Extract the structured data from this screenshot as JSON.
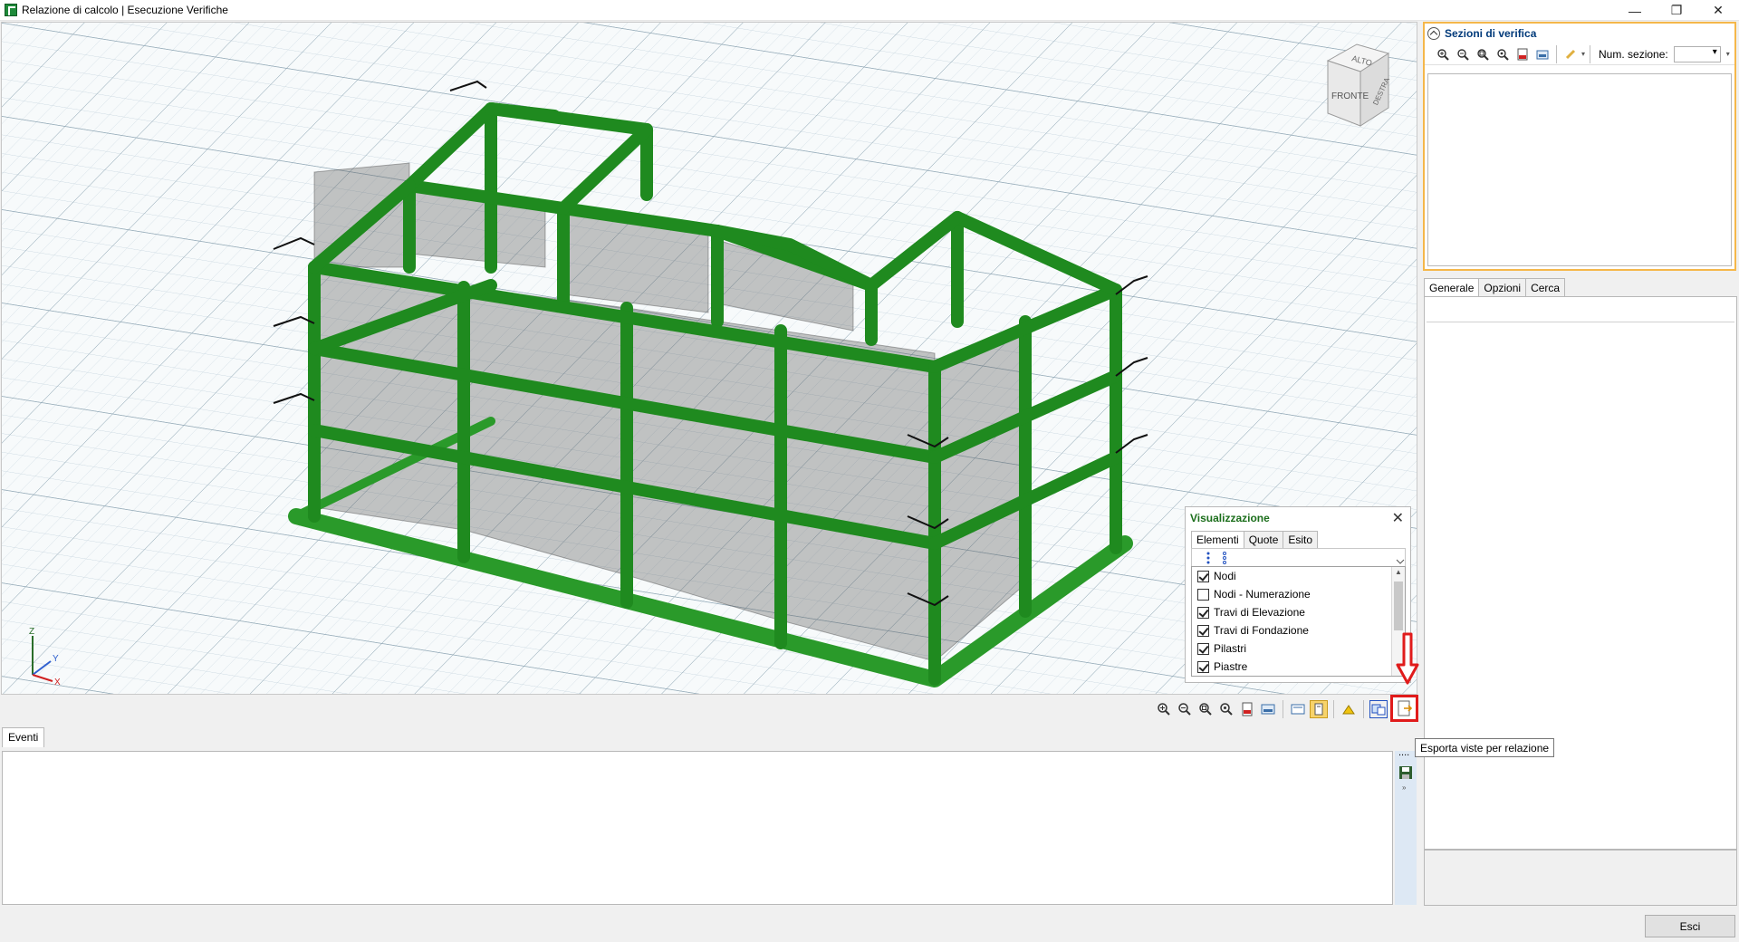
{
  "window": {
    "title": "Relazione di calcolo | Esecuzione Verifiche",
    "controls": {
      "minimize": "—",
      "restore": "❐",
      "close": "✕"
    }
  },
  "viewcube": {
    "top": "ALTO",
    "front": "FRONTE",
    "right": "DESTRA"
  },
  "triad": {
    "x": "X",
    "y": "Y",
    "z": "Z"
  },
  "visualizzazione": {
    "title": "Visualizzazione",
    "close": "✕",
    "tabs": [
      "Elementi",
      "Quote",
      "Esito"
    ],
    "active_tab": "Elementi",
    "items": [
      {
        "label": "Nodi",
        "checked": true
      },
      {
        "label": "Nodi - Numerazione",
        "checked": false
      },
      {
        "label": "Travi di Elevazione",
        "checked": true
      },
      {
        "label": "Travi di Fondazione",
        "checked": true
      },
      {
        "label": "Pilastri",
        "checked": true
      },
      {
        "label": "Piastre",
        "checked": true
      }
    ]
  },
  "view_toolbar": {
    "icons": [
      "zoom-in-icon",
      "zoom-out-icon",
      "zoom-extents-icon",
      "zoom-window-icon",
      "export-pdf-icon",
      "image-icon",
      "settings-icon",
      "layers-icon",
      "perspective-icon",
      "views-icon",
      "grid-icon"
    ],
    "export_tooltip": "Esporta viste per relazione"
  },
  "eventi": {
    "tab_label": "Eventi",
    "menu": "...."
  },
  "sezioni": {
    "title": "Sezioni di verifica",
    "num_label": "Num. sezione:",
    "num_value": ""
  },
  "right_tabs": {
    "labels": [
      "Generale",
      "Opzioni",
      "Cerca"
    ],
    "active": "Generale"
  },
  "footer": {
    "exit_label": "Esci"
  },
  "colors": {
    "structure": "#2fa12f",
    "structure_dark": "#1c6e1c",
    "grid": "#bcd0dc",
    "accent_orange": "#f5b74a",
    "highlight_red": "#e01b1b"
  }
}
